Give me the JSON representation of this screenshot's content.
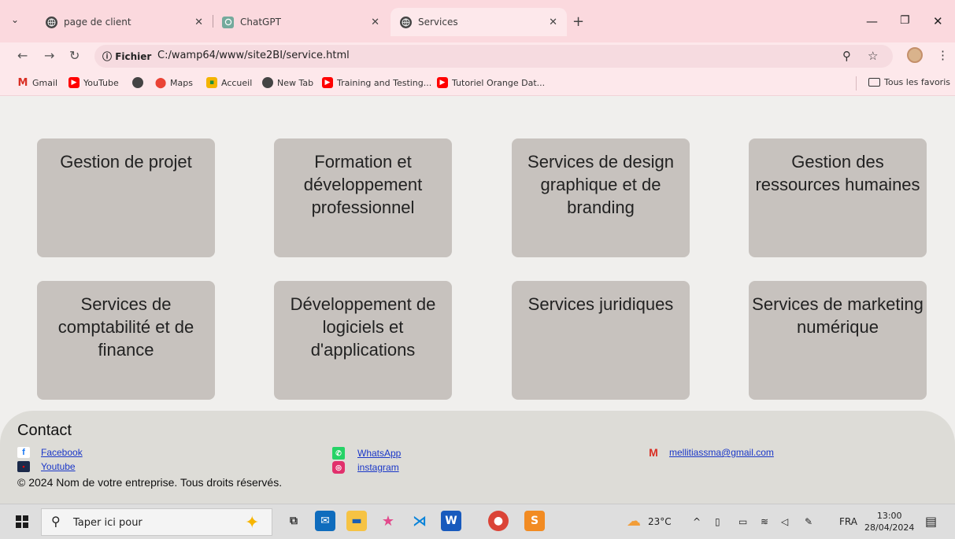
{
  "browser": {
    "tabs": [
      {
        "title": "page de client",
        "active": false
      },
      {
        "title": "ChatGPT",
        "active": false
      },
      {
        "title": "Services",
        "active": true
      }
    ],
    "address": {
      "chip": "Fichier",
      "url": "C:/wamp64/www/site2BI/service.html"
    },
    "bookmarks": [
      {
        "label": "Gmail",
        "icon": "gmail-icon"
      },
      {
        "label": "YouTube",
        "icon": "youtube-icon"
      },
      {
        "label": "",
        "icon": "globe-icon"
      },
      {
        "label": "Maps",
        "icon": "maps-icon"
      },
      {
        "label": "Accueil",
        "icon": "classroom-icon"
      },
      {
        "label": "New Tab",
        "icon": "globe-icon"
      },
      {
        "label": "Training and Testing...",
        "icon": "youtube-icon"
      },
      {
        "label": "Tutoriel Orange Dat...",
        "icon": "youtube-icon"
      }
    ],
    "all_bookmarks": "Tous les favoris"
  },
  "services": [
    "Gestion de projet",
    "Formation et développement professionnel",
    "Services de design graphique et de branding",
    "Gestion des ressources humaines",
    "Services de comptabilité et de finance",
    "Développement de logiciels et d'applications",
    "Services juridiques",
    "Services de marketing numérique"
  ],
  "footer": {
    "heading": "Contact",
    "facebook": "Facebook",
    "youtube": "Youtube",
    "whatsapp": "WhatsApp",
    "instagram": "instagram",
    "email": "mellitiassma@gmail.com",
    "copyright": "© 2024 Nom de votre entreprise. Tous droits réservés."
  },
  "taskbar": {
    "search_placeholder": "Taper ici pour",
    "weather": "23°C",
    "language": "FRA",
    "time": "13:00",
    "date": "28/04/2024"
  },
  "colors": {
    "tab_strip": "#fbd9de",
    "card": "#c7c2be",
    "footer": "#dddcd7",
    "link": "#1a37c8"
  }
}
